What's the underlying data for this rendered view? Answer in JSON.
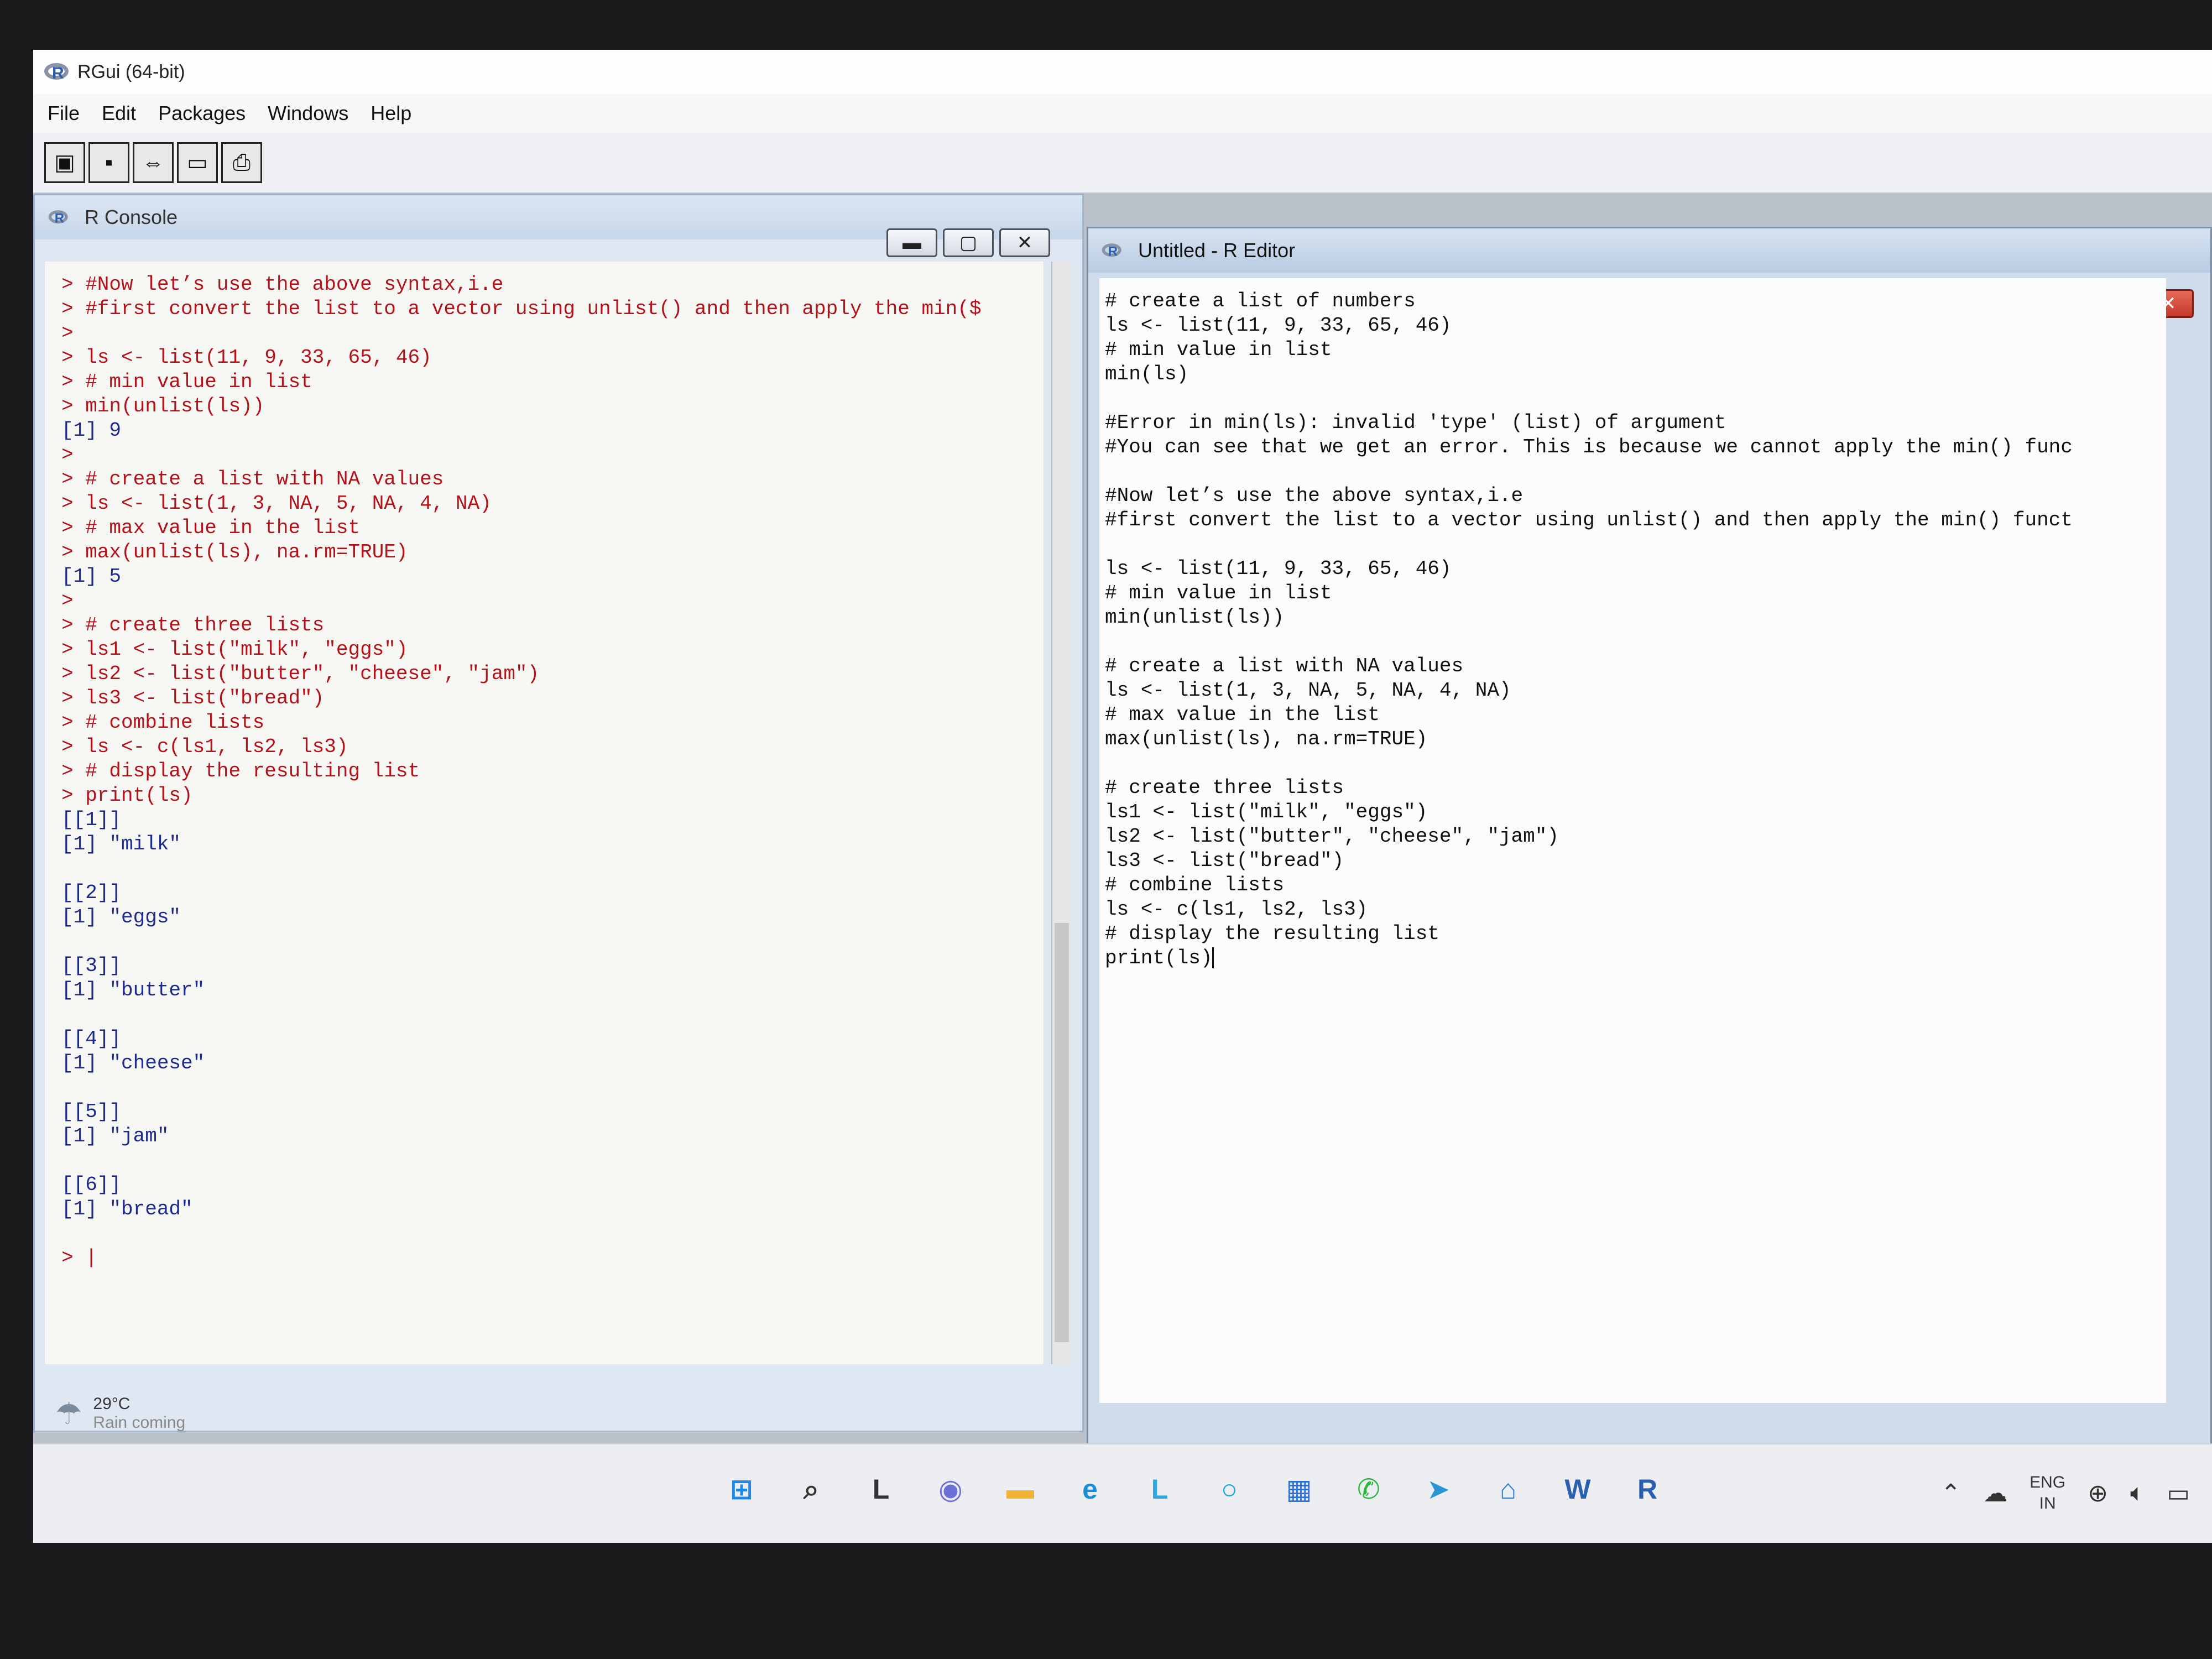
{
  "app": {
    "title": "RGui (64-bit)",
    "menu": [
      "File",
      "Edit",
      "Packages",
      "Windows",
      "Help"
    ],
    "toolbar_icons": [
      "open-script-icon",
      "save-icon",
      "copy-paste-icon",
      "window-icon",
      "print-icon"
    ]
  },
  "console": {
    "title": "R Console",
    "lines": [
      {
        "type": "input",
        "text": "> #Now let’s use the above syntax,i.e"
      },
      {
        "type": "input",
        "text": "> #first convert the list to a vector using unlist() and then apply the min($"
      },
      {
        "type": "input",
        "text": ">"
      },
      {
        "type": "input",
        "text": "> ls <- list(11, 9, 33, 65, 46)"
      },
      {
        "type": "input",
        "text": "> # min value in list"
      },
      {
        "type": "input",
        "text": "> min(unlist(ls))"
      },
      {
        "type": "output",
        "text": "[1] 9"
      },
      {
        "type": "input",
        "text": ">"
      },
      {
        "type": "input",
        "text": "> # create a list with NA values"
      },
      {
        "type": "input",
        "text": "> ls <- list(1, 3, NA, 5, NA, 4, NA)"
      },
      {
        "type": "input",
        "text": "> # max value in the list"
      },
      {
        "type": "input",
        "text": "> max(unlist(ls), na.rm=TRUE)"
      },
      {
        "type": "output",
        "text": "[1] 5"
      },
      {
        "type": "input",
        "text": ">"
      },
      {
        "type": "input",
        "text": "> # create three lists"
      },
      {
        "type": "input",
        "text": "> ls1 <- list(\"milk\", \"eggs\")"
      },
      {
        "type": "input",
        "text": "> ls2 <- list(\"butter\", \"cheese\", \"jam\")"
      },
      {
        "type": "input",
        "text": "> ls3 <- list(\"bread\")"
      },
      {
        "type": "input",
        "text": "> # combine lists"
      },
      {
        "type": "input",
        "text": "> ls <- c(ls1, ls2, ls3)"
      },
      {
        "type": "input",
        "text": "> # display the resulting list"
      },
      {
        "type": "input",
        "text": "> print(ls)"
      },
      {
        "type": "output",
        "text": "[[1]]"
      },
      {
        "type": "output",
        "text": "[1] \"milk\""
      },
      {
        "type": "output",
        "text": ""
      },
      {
        "type": "output",
        "text": "[[2]]"
      },
      {
        "type": "output",
        "text": "[1] \"eggs\""
      },
      {
        "type": "output",
        "text": ""
      },
      {
        "type": "output",
        "text": "[[3]]"
      },
      {
        "type": "output",
        "text": "[1] \"butter\""
      },
      {
        "type": "output",
        "text": ""
      },
      {
        "type": "output",
        "text": "[[4]]"
      },
      {
        "type": "output",
        "text": "[1] \"cheese\""
      },
      {
        "type": "output",
        "text": ""
      },
      {
        "type": "output",
        "text": "[[5]]"
      },
      {
        "type": "output",
        "text": "[1] \"jam\""
      },
      {
        "type": "output",
        "text": ""
      },
      {
        "type": "output",
        "text": "[[6]]"
      },
      {
        "type": "output",
        "text": "[1] \"bread\""
      },
      {
        "type": "output",
        "text": ""
      },
      {
        "type": "prompt",
        "text": "> |"
      }
    ]
  },
  "editor": {
    "title": "Untitled - R Editor",
    "lines": [
      "# create a list of numbers",
      "ls <- list(11, 9, 33, 65, 46)",
      "# min value in list",
      "min(ls)",
      "",
      "#Error in min(ls): invalid 'type' (list) of argument",
      "#You can see that we get an error. This is because we cannot apply the min() func",
      "",
      "#Now let’s use the above syntax,i.e",
      "#first convert the list to a vector using unlist() and then apply the min() funct",
      "",
      "ls <- list(11, 9, 33, 65, 46)",
      "# min value in list",
      "min(unlist(ls))",
      "",
      "# create a list with NA values",
      "ls <- list(1, 3, NA, 5, NA, 4, NA)",
      "# max value in the list",
      "max(unlist(ls), na.rm=TRUE)",
      "",
      "# create three lists",
      "ls1 <- list(\"milk\", \"eggs\")",
      "ls2 <- list(\"butter\", \"cheese\", \"jam\")",
      "ls3 <- list(\"bread\")",
      "# combine lists",
      "ls <- c(ls1, ls2, ls3)",
      "# display the resulting list",
      "print(ls)"
    ]
  },
  "weather": {
    "temp": "29°C",
    "desc": "Rain coming"
  },
  "taskbar": {
    "apps": [
      {
        "name": "start-icon",
        "glyph": "⊞",
        "color": "#1e88e5"
      },
      {
        "name": "search-icon",
        "glyph": "⌕",
        "color": "#333333"
      },
      {
        "name": "task-view-icon",
        "glyph": "L",
        "color": "#333333"
      },
      {
        "name": "chat-icon",
        "glyph": "◉",
        "color": "#6b6fd6"
      },
      {
        "name": "file-explorer-icon",
        "glyph": "▬",
        "color": "#f2b233"
      },
      {
        "name": "edge-icon",
        "glyph": "e",
        "color": "#1a8fd6"
      },
      {
        "name": "app-l-icon",
        "glyph": "L",
        "color": "#2aa6e0"
      },
      {
        "name": "app-circle-icon",
        "glyph": "○",
        "color": "#0aa6d6"
      },
      {
        "name": "store-icon",
        "glyph": "▦",
        "color": "#2a6fd6"
      },
      {
        "name": "whatsapp-icon",
        "glyph": "✆",
        "color": "#2bb741"
      },
      {
        "name": "telegram-icon",
        "glyph": "➤",
        "color": "#2a95d6"
      },
      {
        "name": "remote-icon",
        "glyph": "⌂",
        "color": "#2a7fd6"
      },
      {
        "name": "word-icon",
        "glyph": "W",
        "color": "#2b5fb0"
      },
      {
        "name": "r-icon",
        "glyph": "R",
        "color": "#2b5fb0"
      }
    ]
  },
  "tray": {
    "lang_top": "ENG",
    "lang_bottom": "IN"
  },
  "colors": {
    "console_input": "#b3121b",
    "console_output": "#1c2a8c"
  }
}
